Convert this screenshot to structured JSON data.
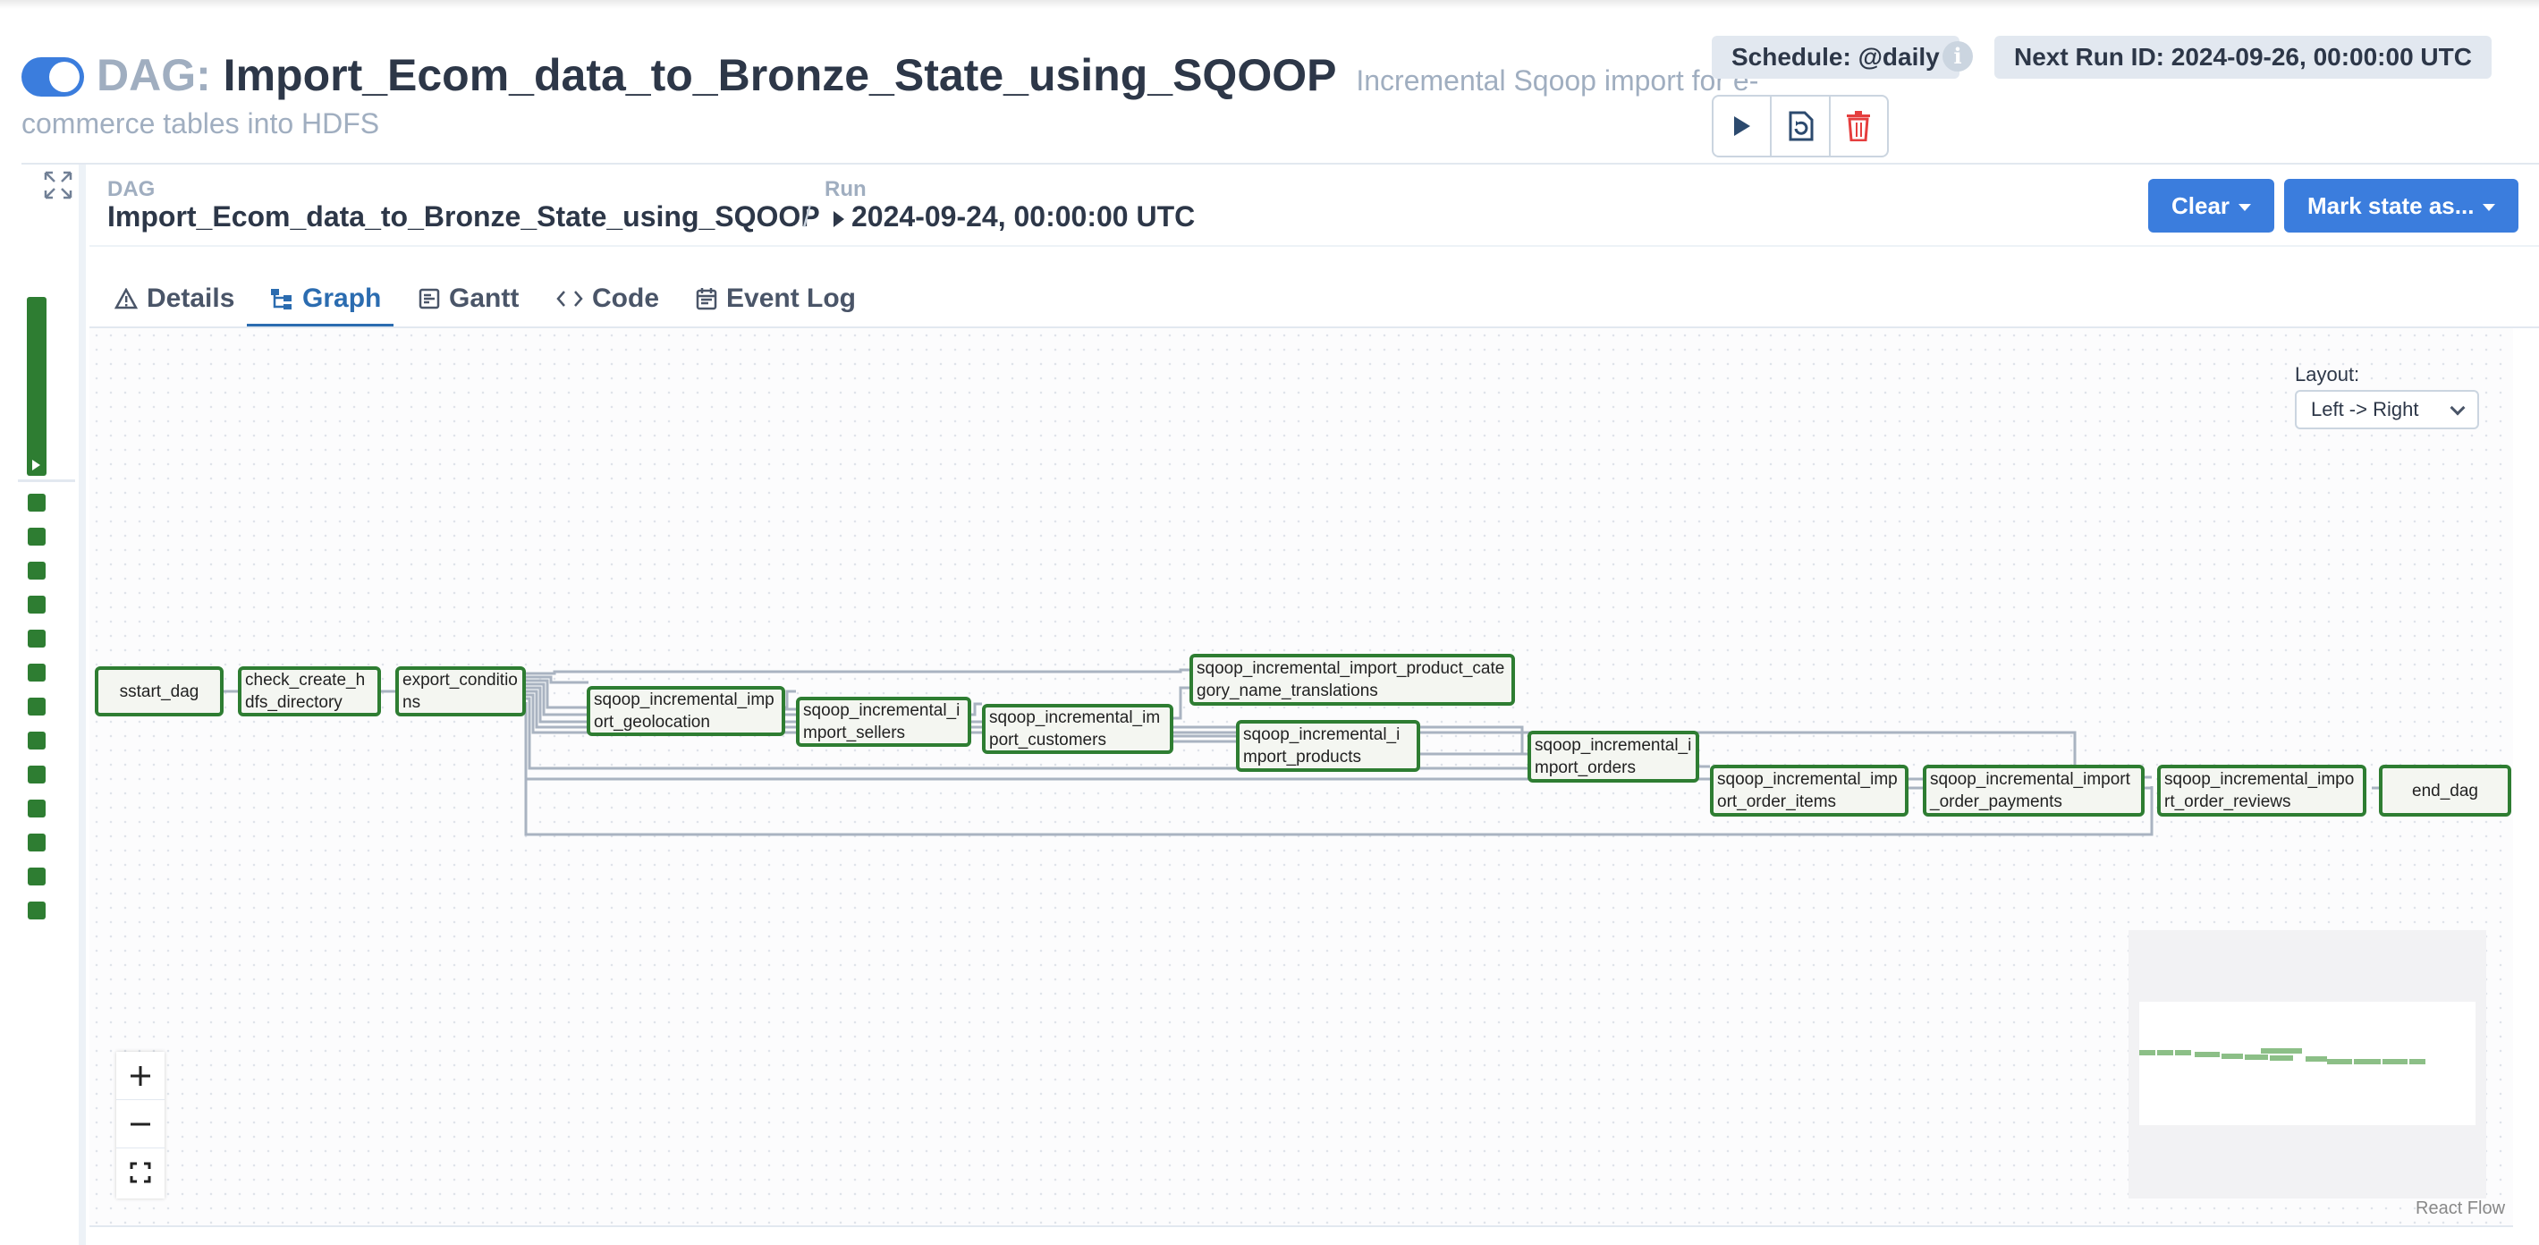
{
  "header": {
    "dag_label": "DAG:",
    "dag_id": "Import_Ecom_data_to_Bronze_State_using_SQOOP",
    "description_line1": "Incremental Sqoop import for e-",
    "description_line2": "commerce tables into HDFS",
    "schedule": "Schedule: @daily",
    "next_run": "Next Run ID: 2024-09-26, 00:00:00 UTC",
    "toggle_on": true,
    "actions": [
      "play-icon",
      "reparse-icon",
      "trash-icon"
    ]
  },
  "breadcrumb": {
    "dag_label": "DAG",
    "dag_value": "Import_Ecom_data_to_Bronze_State_using_SQOOP",
    "separator": "/",
    "run_label": "Run",
    "run_value": "2024-09-24, 00:00:00 UTC"
  },
  "buttons": {
    "clear": "Clear",
    "mark_state": "Mark state as..."
  },
  "tabs": [
    {
      "label": "Details",
      "icon": "warning-triangle-icon"
    },
    {
      "label": "Graph",
      "icon": "graph-icon",
      "active": true
    },
    {
      "label": "Gantt",
      "icon": "gantt-icon"
    },
    {
      "label": "Code",
      "icon": "code-icon"
    },
    {
      "label": "Event Log",
      "icon": "calendar-icon"
    }
  ],
  "layout": {
    "label": "Layout:",
    "value": "Left -> Right"
  },
  "graph": {
    "state_color": "#2e7d32",
    "nodes": [
      {
        "id": "sstart_dag",
        "label": "sstart_dag"
      },
      {
        "id": "check_create_hdfs_directory",
        "label": "check_create_hdfs_directory"
      },
      {
        "id": "export_conditions",
        "label": "export_conditions"
      },
      {
        "id": "geolocation",
        "label": "sqoop_incremental_import_geolocation"
      },
      {
        "id": "sellers",
        "label": "sqoop_incremental_import_sellers"
      },
      {
        "id": "customers",
        "label": "sqoop_incremental_import_customers"
      },
      {
        "id": "translations",
        "label": "sqoop_incremental_import_product_category_name_translations"
      },
      {
        "id": "products",
        "label": "sqoop_incremental_import_products"
      },
      {
        "id": "orders",
        "label": "sqoop_incremental_import_orders"
      },
      {
        "id": "order_items",
        "label": "sqoop_incremental_import_order_items"
      },
      {
        "id": "order_payments",
        "label": "sqoop_incremental_import_order_payments"
      },
      {
        "id": "order_reviews",
        "label": "sqoop_incremental_import_order_reviews"
      },
      {
        "id": "end_dag",
        "label": "end_dag"
      }
    ]
  },
  "footer": {
    "react_flow": "React Flow"
  },
  "colors": {
    "accent": "#3b7ddd",
    "success": "#2e7d32",
    "edge": "#a9b3c1"
  }
}
